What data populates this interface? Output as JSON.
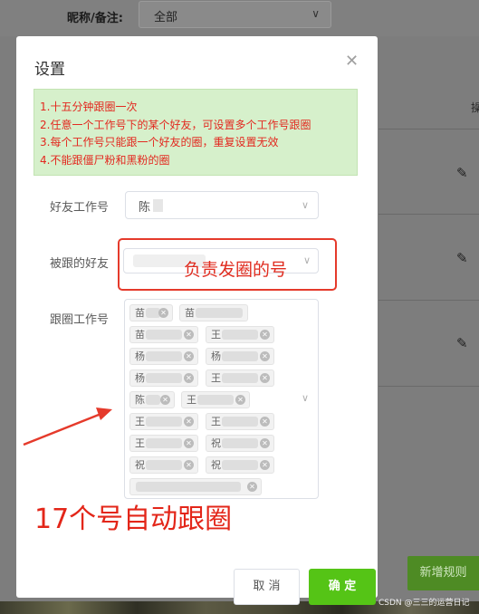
{
  "background": {
    "filter_label": "昵称/备注:",
    "filter_value": "全部",
    "add_rule_button": "新增规则",
    "watermark": "CSDN @三三的运营日记"
  },
  "dialog": {
    "title": "设置",
    "notice": [
      "1.十五分钟跟圈一次",
      "2.任意一个工作号下的某个好友，可设置多个工作号跟圈",
      "3.每个工作号只能跟一个好友的圈，重复设置无效",
      "4.不能跟僵尸粉和黑粉的圈"
    ],
    "friend_account_label": "好友工作号",
    "friend_account_value": "陈",
    "followed_friend_label": "被跟的好友",
    "follow_accounts_label": "跟圈工作号",
    "follow_accounts": [
      "苗",
      "苗",
      "苗",
      "王",
      "杨",
      "杨",
      "杨",
      "王",
      "陈",
      "王",
      "王",
      "王",
      "王",
      "祝",
      "祝",
      "祝",
      ""
    ],
    "cancel_button": "取 消",
    "confirm_button": "确 定"
  },
  "annotations": {
    "posting_account": "负责发圈的号",
    "auto_follow": "17个号自动跟圈"
  },
  "colors": {
    "notice_text": "#e3281f",
    "notice_bg": "#d6f0cb",
    "confirm_bg": "#55c416",
    "annotation_red": "#e53a2b"
  }
}
